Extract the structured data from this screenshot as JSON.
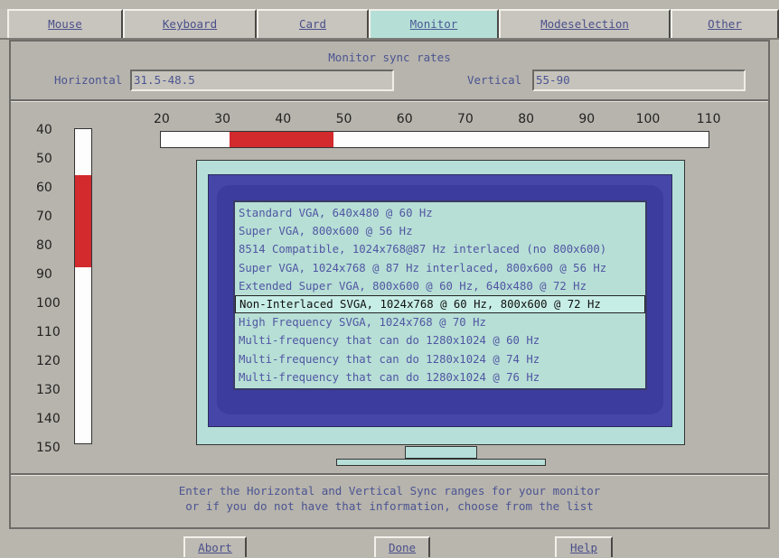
{
  "tabs": [
    {
      "label": "Mouse",
      "active": false
    },
    {
      "label": "Keyboard",
      "active": false
    },
    {
      "label": "Card",
      "active": false
    },
    {
      "label": "Monitor",
      "active": true
    },
    {
      "label": "Modeselection",
      "active": false
    },
    {
      "label": "Other",
      "active": false
    }
  ],
  "title": "Monitor sync rates",
  "horizontal": {
    "label": "Horizontal",
    "value": "31.5-48.5"
  },
  "vertical": {
    "label": "Vertical",
    "value": "55-90"
  },
  "vertical_scale": {
    "ticks": [
      "40",
      "50",
      "60",
      "70",
      "80",
      "90",
      "100",
      "110",
      "120",
      "130",
      "140",
      "150"
    ],
    "range": [
      40,
      150
    ],
    "selected_range": [
      55,
      90
    ]
  },
  "horizontal_scale": {
    "ticks": [
      "20",
      "30",
      "40",
      "50",
      "60",
      "70",
      "80",
      "90",
      "100",
      "110"
    ],
    "range": [
      20,
      110
    ],
    "selected_range": [
      31.5,
      48.5
    ]
  },
  "monitor_modes": [
    "Standard VGA, 640x480 @ 60 Hz",
    "Super VGA, 800x600 @ 56 Hz",
    "8514 Compatible, 1024x768@87 Hz interlaced (no 800x600)",
    "Super VGA, 1024x768 @ 87 Hz interlaced, 800x600 @ 56 Hz",
    "Extended Super VGA, 800x600 @ 60 Hz, 640x480 @ 72 Hz",
    "Non-Interlaced SVGA, 1024x768 @ 60 Hz, 800x600 @ 72 Hz",
    "High Frequency SVGA, 1024x768 @ 70 Hz",
    "Multi-frequency that can do 1280x1024 @ 60 Hz",
    "Multi-frequency that can do 1280x1024 @ 74 Hz",
    "Multi-frequency that can do 1280x1024 @ 76 Hz"
  ],
  "selected_mode_index": 5,
  "help_text": [
    "Enter the Horizontal and Vertical Sync ranges for your monitor",
    "or if you do not have that information, choose from the list"
  ],
  "buttons": {
    "abort": "Abort",
    "done": "Done",
    "help": "Help"
  },
  "colors": {
    "accent": "#b5dfd6",
    "range_fill": "#d22a2d",
    "text": "#4b5491"
  }
}
